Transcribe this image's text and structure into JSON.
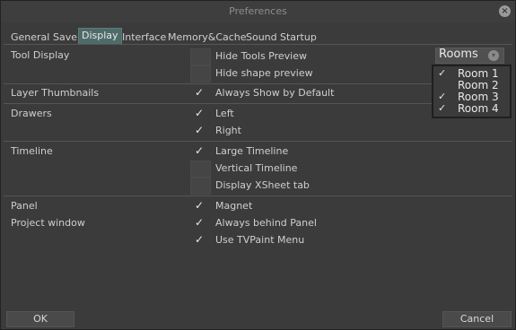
{
  "window": {
    "title": "Preferences"
  },
  "tabs": [
    {
      "label": "General"
    },
    {
      "label": "Save"
    },
    {
      "label": "Display",
      "active": true
    },
    {
      "label": "Interface"
    },
    {
      "label": "Memory&Cache"
    },
    {
      "label": "Sound"
    },
    {
      "label": "Startup"
    }
  ],
  "sections": {
    "tool_display": {
      "label": "Tool Display",
      "options": [
        {
          "label": "Hide Tools Preview",
          "checked": false
        },
        {
          "label": "Hide shape preview",
          "checked": false
        }
      ]
    },
    "layer_thumbnails": {
      "label": "Layer Thumbnails",
      "options": [
        {
          "label": "Always Show by Default",
          "checked": true
        }
      ]
    },
    "drawers": {
      "label": "Drawers",
      "options": [
        {
          "label": "Left",
          "checked": true
        },
        {
          "label": "Right",
          "checked": true
        }
      ]
    },
    "timeline": {
      "label": "Timeline",
      "options": [
        {
          "label": "Large Timeline",
          "checked": true
        },
        {
          "label": "Vertical Timeline",
          "checked": false
        },
        {
          "label": "Display XSheet tab",
          "checked": false
        }
      ]
    },
    "panel": {
      "label": "Panel",
      "options": [
        {
          "label": "Magnet",
          "checked": true
        }
      ]
    },
    "project_window": {
      "label": "Project window",
      "options": [
        {
          "label": "Always behind Panel",
          "checked": true
        },
        {
          "label": "Use TVPaint Menu",
          "checked": true
        }
      ]
    }
  },
  "rooms": {
    "label": "Rooms",
    "items": [
      {
        "label": "Room 1",
        "checked": true
      },
      {
        "label": "Room 2",
        "checked": false
      },
      {
        "label": "Room 3",
        "checked": true
      },
      {
        "label": "Room 4",
        "checked": true
      }
    ]
  },
  "footer": {
    "ok_label": "OK",
    "cancel_label": "Cancel"
  },
  "icons": {
    "check": "✓",
    "close": "×",
    "chevron": "▾"
  },
  "colors": {
    "active_tab": "#4e6b6a",
    "background": "#3b3b3b"
  }
}
